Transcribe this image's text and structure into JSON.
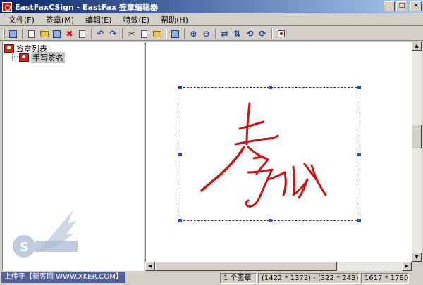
{
  "window": {
    "title": "EastFaxCSign - EastFax 签章编辑器",
    "minimize": "_",
    "maximize": "□",
    "close": "×"
  },
  "menu": [
    {
      "label": "文件(F)"
    },
    {
      "label": "签章(M)"
    },
    {
      "label": "编辑(E)"
    },
    {
      "label": "特效(E)"
    },
    {
      "label": "帮助(H)"
    }
  ],
  "toolbar": {
    "icons": [
      "save-icon",
      "new-stamp-icon",
      "open-stamp-icon",
      "edit-stamp-icon",
      "delete-icon",
      "properties-icon",
      "undo-icon",
      "redo-icon",
      "cut-icon",
      "copy-icon",
      "paste-icon",
      "fit-icon",
      "zoom-in-icon",
      "zoom-out-icon",
      "flip-horizontal-icon",
      "flip-vertical-icon",
      "rotate-left-icon",
      "rotate-right-icon",
      "red-stamp-icon"
    ]
  },
  "tree": {
    "root_label": "签章列表",
    "child_label": "手写签名"
  },
  "status": {
    "count": "1 个签章",
    "coords": "(1422 * 1373) - (322 * 243)",
    "size": "1617 * 1780"
  },
  "watermark": {
    "upload_text": "上传于【新客网 WWW.XKER.COM】"
  },
  "colors": {
    "title_start": "#0a246a",
    "title_end": "#a6caf0",
    "signature_red": "#c81414",
    "handle_blue": "#1f4fd6"
  }
}
